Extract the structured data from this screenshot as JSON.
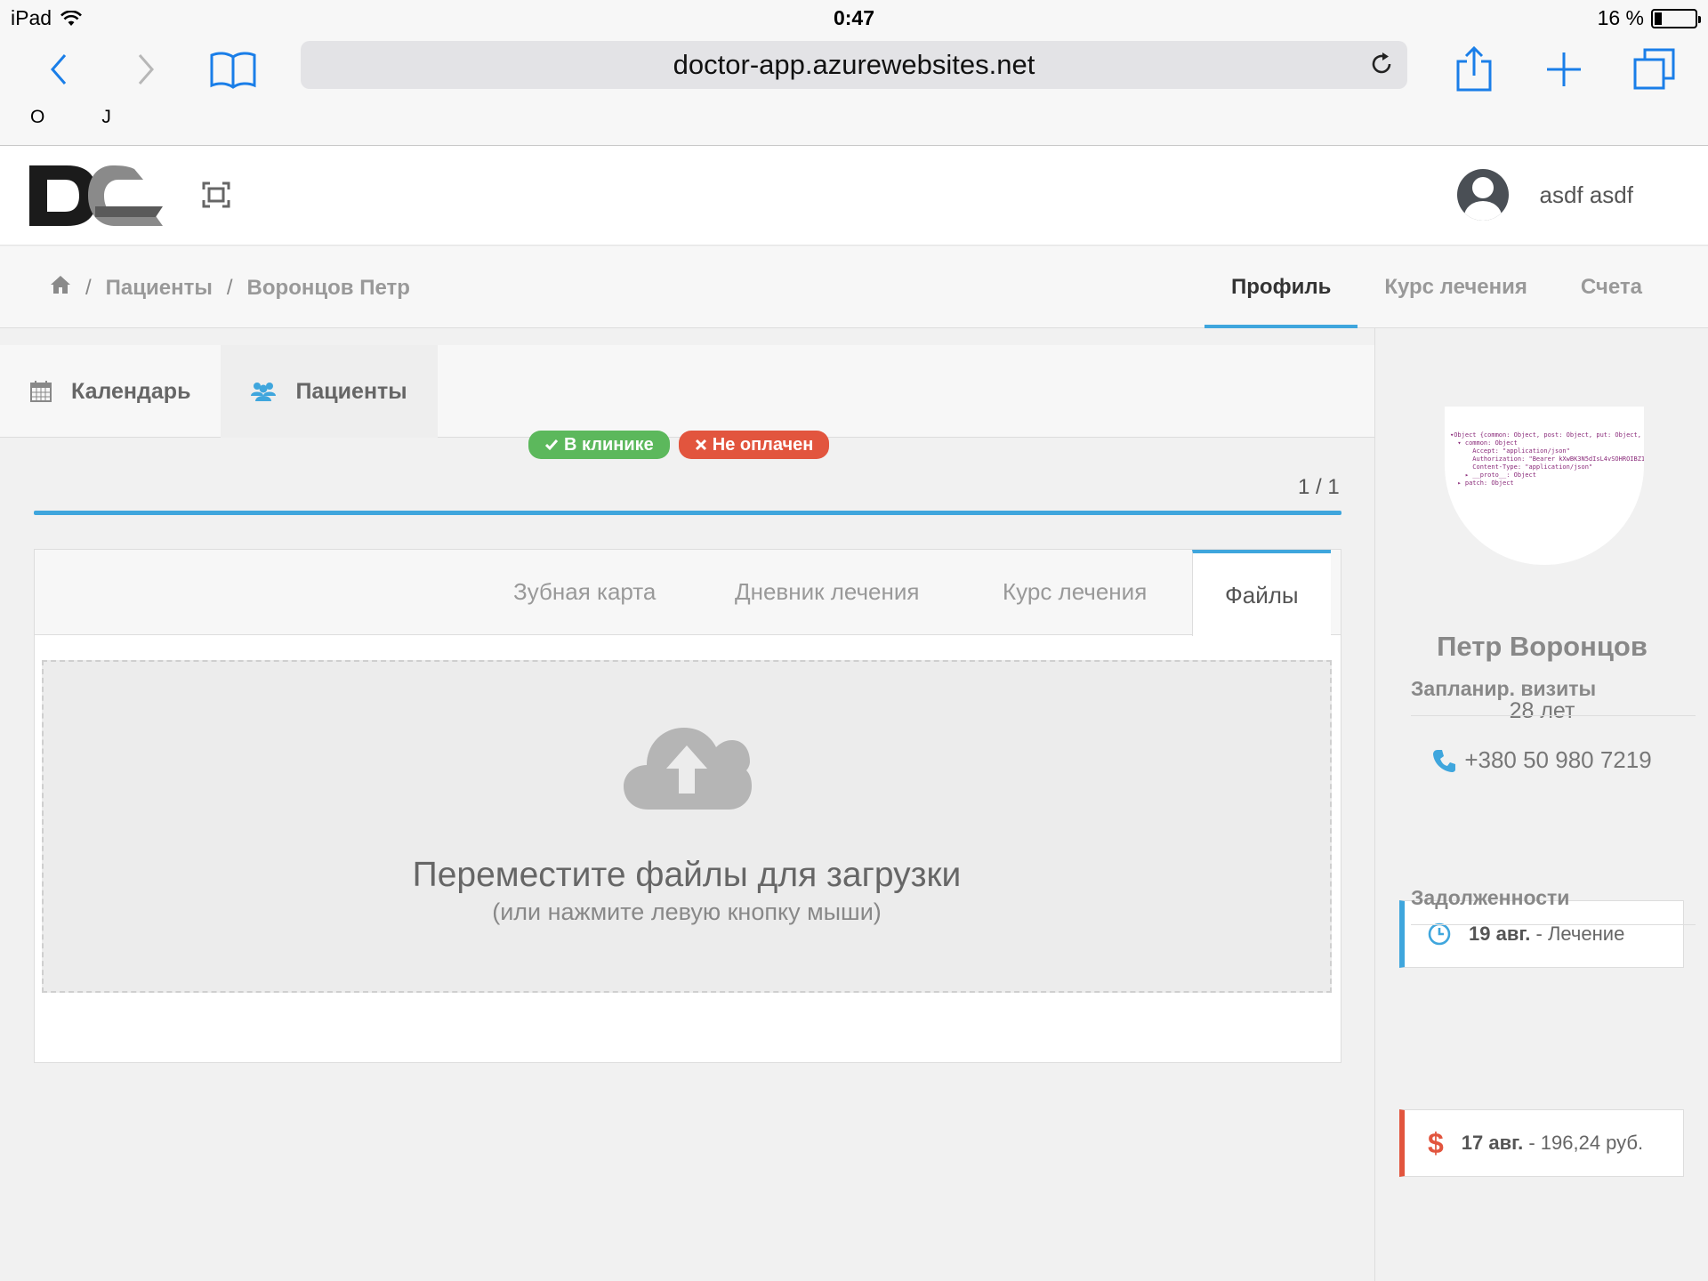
{
  "statusbar": {
    "device": "iPad",
    "time": "0:47",
    "battery": "16 %"
  },
  "browser": {
    "url": "doctor-app.azurewebsites.net",
    "bookmarks": [
      "O",
      "J"
    ],
    "icons": [
      "back-icon",
      "forward-icon",
      "bookmarks-icon",
      "reload-icon",
      "share-icon",
      "new-tab-icon",
      "tabs-icon"
    ]
  },
  "header": {
    "user_name": "asdf asdf"
  },
  "breadcrumb": {
    "items": [
      "Пациенты",
      "Воронцов Петр"
    ]
  },
  "profile_tabs": [
    "Профиль",
    "Курс лечения",
    "Счета"
  ],
  "app_nav": [
    {
      "label": "Календарь",
      "icon": "calendar-icon"
    },
    {
      "label": "Пациенты",
      "icon": "users-icon"
    }
  ],
  "patient_status": {
    "in_clinic": "В клинике",
    "unpaid": "Не оплачен"
  },
  "pager": "1 / 1",
  "content_tabs": [
    "Зубная карта",
    "Дневник лечения",
    "Курс лечения",
    "Файлы"
  ],
  "dropzone": {
    "title": "Переместите файлы для загрузки",
    "subtitle": "(или нажмите левую кнопку мыши)"
  },
  "patient": {
    "name": "Петр Воронцов",
    "age": "28 лет",
    "phone": "+380 50 980 7219"
  },
  "planned_visits": {
    "title": "Запланир. визиты",
    "items": [
      {
        "date": "19 авг.",
        "text": "- Лечение"
      }
    ]
  },
  "debts": {
    "title": "Задолженности",
    "items": [
      {
        "date": "17 авг.",
        "text": "- 196,24 руб."
      }
    ]
  },
  "colors": {
    "accent": "#3fa6dd",
    "success": "#5cb85c",
    "danger": "#e2553e"
  }
}
